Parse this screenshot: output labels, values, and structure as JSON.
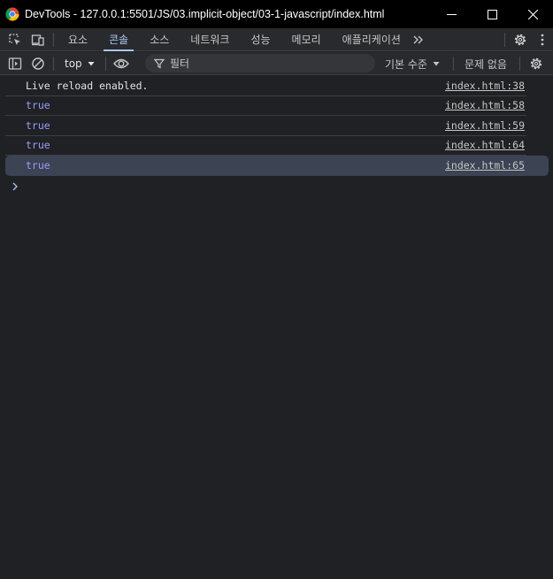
{
  "window": {
    "title": "DevTools - 127.0.0.1:5501/JS/03.implicit-object/03-1-javascript/index.html"
  },
  "tabs": [
    {
      "label": "요소",
      "active": false
    },
    {
      "label": "콘솔",
      "active": true
    },
    {
      "label": "소스",
      "active": false
    },
    {
      "label": "네트워크",
      "active": false
    },
    {
      "label": "성능",
      "active": false
    },
    {
      "label": "메모리",
      "active": false
    },
    {
      "label": "애플리케이션",
      "active": false
    }
  ],
  "console_toolbar": {
    "context": "top",
    "filter_placeholder": "필터",
    "levels": "기본 수준",
    "issues": "문제 없음"
  },
  "messages": [
    {
      "text": "Live reload enabled.",
      "type": "plain",
      "source": "index.html:38"
    },
    {
      "text": "true",
      "type": "bool",
      "source": "index.html:58"
    },
    {
      "text": "true",
      "type": "bool",
      "source": "index.html:59"
    },
    {
      "text": "true",
      "type": "bool",
      "source": "index.html:64"
    },
    {
      "text": "true",
      "type": "bool",
      "source": "index.html:65"
    }
  ],
  "colors": {
    "background": "#202124",
    "active_tab": "#a8c7fa",
    "boolean_value": "#9a9cff",
    "selected_row": "#3c4353"
  }
}
